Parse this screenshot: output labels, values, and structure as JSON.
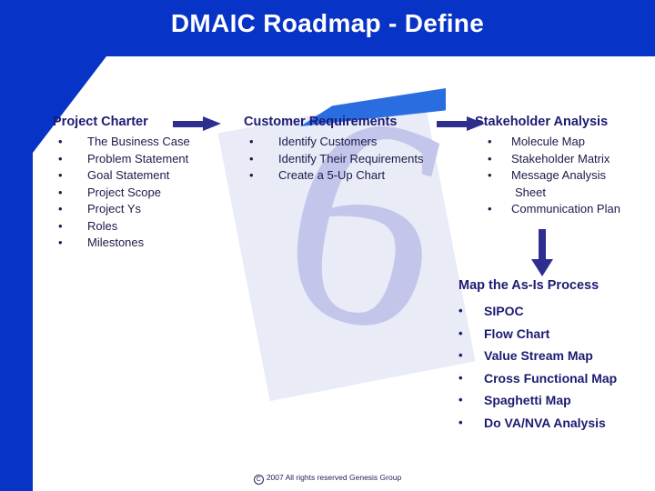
{
  "slide": {
    "title": "DMAIC Roadmap - Define",
    "accent_blue": "#0733C6",
    "navy": "#1B1B72",
    "arrow_navy": "#2E2E8F",
    "watermark_glyph": "6",
    "watermark_color": "#c3c6ea"
  },
  "columns": {
    "charter": {
      "heading": "Project Charter",
      "items": [
        "The Business Case",
        "Problem Statement",
        "Goal Statement",
        "Project Scope",
        "Project Ys",
        "Roles",
        "Milestones"
      ]
    },
    "requirements": {
      "heading": "Customer Requirements",
      "items": [
        "Identify Customers",
        "Identify Their Requirements",
        "Create a 5-Up Chart"
      ]
    },
    "stakeholder": {
      "heading": "Stakeholder Analysis",
      "items": [
        "Molecule Map",
        "Stakeholder Matrix",
        "Message Analysis",
        "Communication Plan"
      ],
      "item_2_continuation": "Sheet"
    },
    "asis": {
      "heading": "Map the As-Is Process",
      "items": [
        "SIPOC",
        "Flow Chart",
        "Value Stream Map",
        "Cross Functional Map",
        "Spaghetti Map",
        "Do VA/NVA Analysis"
      ]
    }
  },
  "arrows": {
    "charter_to_requirements": "arrow-right",
    "requirements_to_stakeholder": "arrow-right",
    "stakeholder_to_asis": "arrow-down"
  },
  "footer": {
    "copyright_symbol": "C",
    "text": "2007 All rights reserved Genesis Group"
  },
  "bullet_char": "•"
}
